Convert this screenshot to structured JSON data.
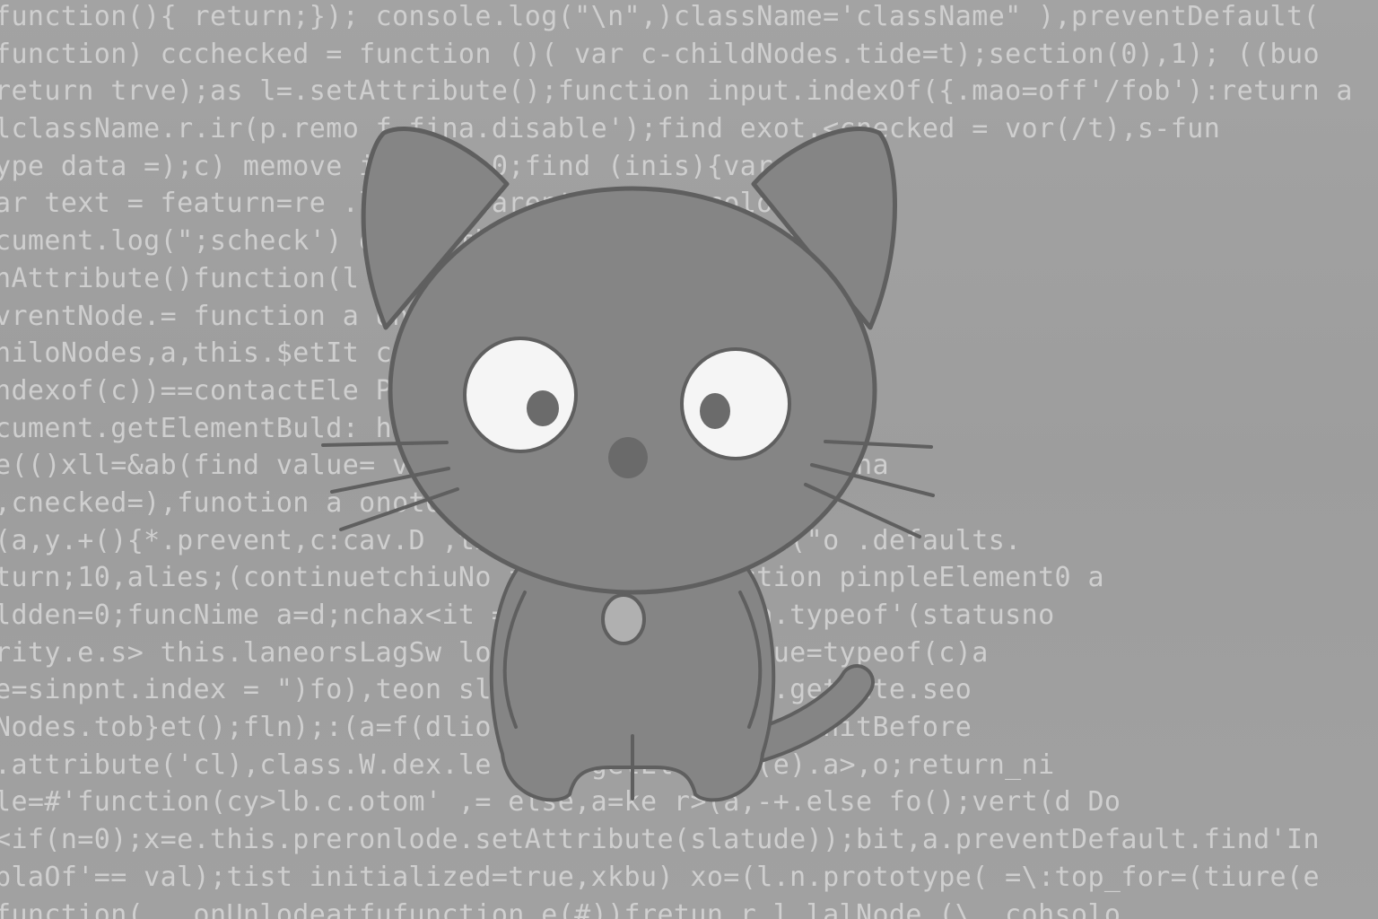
{
  "background": {
    "color": "#9e9e9e",
    "code_color": "#d2d2d2",
    "code_lines": [
      "function(){ return;}); console.log(\"\\n\",)className='className\" ),preventDefault(",
      "function) ccchecked = function ()( var c-childNodes.tide=t);section(0),1); ((buo",
      "return trve);as l=.setAttribute();function input.indexOf({.mao=off'/fob'):return a",
      "lclassName.r.ir(p.remo f,fina.disable');find exot.<cnecked = vor(/t),s-fun",
      "ype data =);c) memove ireturn 0;find (inis){var h=",
      "ar text = featurn=re .loedTo=parent/?elips=color(",
      "cument.log(\";scheck') d,',\".this.input:ndexOf(e.mad",
      "nAttribute()function(l lt(i = true typeof dp)ect(t));",
      "vrentNode.= function a Untl&Index V= 'inou\".:olIdTdmh",
      "hiloNodes,a,this.$etIt ctumenteElement.lB&d.&stingCe",
      "ndexof(c))==contactEle P)e:fe(if(s(ihis)));a=()=d.c",
      "cument.getElementBuld: hPreventBefault(ch);== b,a_b",
      "e(()xll=&ab(find value= ve.os,data,tocomplete 0;c:clha",
      ",cnecked=),funotion a onot0),(var c.preventzFo_Ju(",
      "(a,y.+(){*.prevent,c:cav.D ,txtVe.getElemchtById(\"o .defaults.",
      "turn;10,alies;(continuetchiuNo funcnnine'.function pinpleElement0 a",
      "ldden=0;funcNime a=d;nchax<it =deN.trbibute();a.typeof'(statusno",
      "rity.e.s> this.laneorsLagSw loint(this);\"'))),&ue=typeof(c)a",
      "e=sinpnt.index = \")fo),teon sli ,isTab(s,i)}(Cl.getDate.seo",
      "Nodes.tob}et();fln);:(a=f(dlio (a)pie?<u>,k.cclonInitBefore",
      ".attribute('cl),class.W.dex.le >,ue.getElement(e).a>,o;return_ni",
      "le=#'function(cy>lb.c.otom' ,= else,a=ke r>(a,-+.else fo();vert(d Do",
      "<if(n=0);x=e.this.preronlode.setAttribute(slatude));bit,a.preventDefault.find'In",
      "plaOf'== val);tist initialized=true,xkbu) xo=(l.n.prototype( =\\:top_for=(tiure(e",
      "function(...onUnlodeatfufunction.e(#))fretun r.l.lalNode.(\\..cohsolo"
    ]
  },
  "cat": {
    "body_color": "#858585",
    "outline_color": "#5f5f5f",
    "eye_white": "#f5f5f5",
    "pupil_color": "#6b6b6b",
    "nose_color": "#6a6a6a",
    "tag_color": "#b0b0b0"
  }
}
